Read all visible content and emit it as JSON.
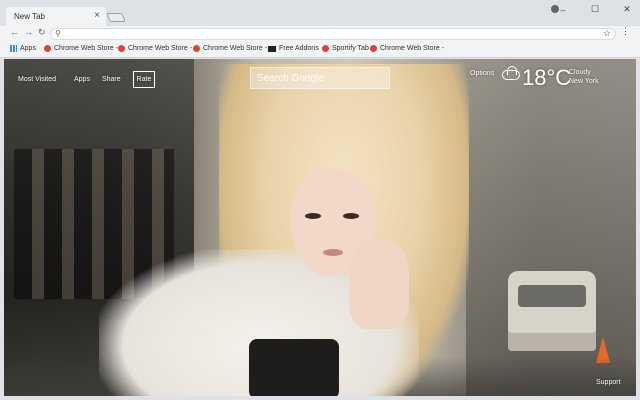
{
  "browser": {
    "tab_title": "New Tab",
    "tab_close": "×",
    "window_controls": {
      "minimize": "–",
      "maximize": "☐",
      "close": "✕"
    },
    "bookmarks": [
      {
        "label": "Apps",
        "icon": "apps-grid-icon"
      },
      {
        "label": "Chrome Web Store -",
        "icon": "chrome-store-icon"
      },
      {
        "label": "Chrome Web Store -",
        "icon": "chrome-store-icon"
      },
      {
        "label": "Chrome Web Store -",
        "icon": "chrome-store-icon"
      },
      {
        "label": "Free Addons",
        "icon": "addons-icon"
      },
      {
        "label": "Sportify Tab",
        "icon": "chrome-store-icon"
      },
      {
        "label": "Chrome Web Store -",
        "icon": "chrome-store-icon"
      }
    ]
  },
  "page": {
    "nav": {
      "most_visited": "Most Visited",
      "apps": "Apps",
      "share": "Share",
      "rate": "Rate"
    },
    "search": {
      "placeholder": "Search Google"
    },
    "options": "Options",
    "weather": {
      "temperature": "18°C",
      "condition": "Cloudy",
      "location": "New York",
      "icon": "cloud-icon"
    },
    "support": "Support"
  },
  "colors": {
    "chrome_bar": "#dee1e6",
    "toolbar": "#f2f3f5",
    "overlay_text": "#ffffff"
  }
}
